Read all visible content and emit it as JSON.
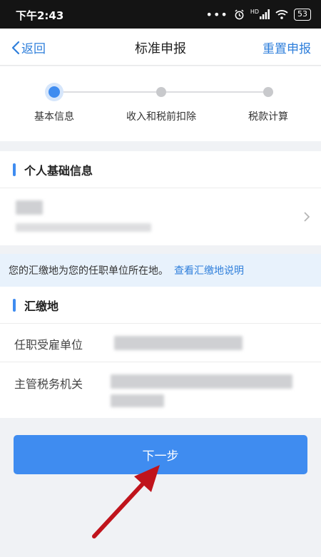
{
  "status_bar": {
    "time": "下午2:43",
    "battery": "53",
    "network": "HD"
  },
  "nav": {
    "back_label": "返回",
    "title": "标准申报",
    "reset_label": "重置申报"
  },
  "stepper": {
    "steps": [
      {
        "label": "基本信息",
        "active": true
      },
      {
        "label": "收入和税前扣除",
        "active": false
      },
      {
        "label": "税款计算",
        "active": false
      }
    ]
  },
  "personal_info": {
    "section_title": "个人基础信息"
  },
  "notice": {
    "text": "您的汇缴地为您的任职单位所在地。",
    "link": "查看汇缴地说明"
  },
  "remit_location": {
    "section_title": "汇缴地",
    "employer_label": "任职受雇单位",
    "tax_authority_label": "主管税务机关"
  },
  "actions": {
    "next_label": "下一步"
  },
  "colors": {
    "accent": "#3f8cf0",
    "link": "#2f7fdb",
    "annotation_arrow": "#c0141c"
  }
}
